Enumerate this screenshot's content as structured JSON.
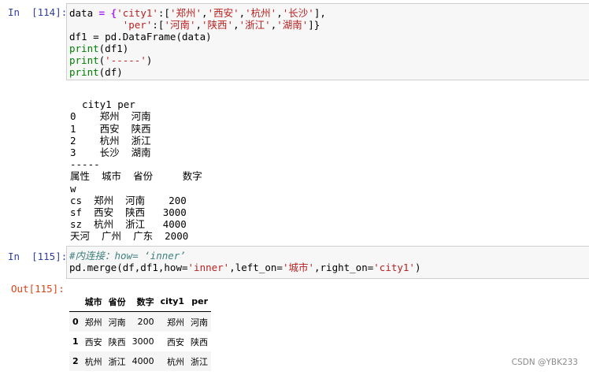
{
  "cell1": {
    "prompt": "In  [114]:",
    "code": {
      "l1_a": "data",
      "l1_b": " = {",
      "l1_c": "'city1'",
      "l1_d": ":[",
      "l1_e": "'郑州'",
      "l1_f": ",",
      "l1_g": "'西安'",
      "l1_h": ",",
      "l1_i": "'杭州'",
      "l1_j": ",",
      "l1_k": "'长沙'",
      "l1_l": "],",
      "l2_indent": "         ",
      "l2_a": "'per'",
      "l2_b": ":[",
      "l2_c": "'河南'",
      "l2_d": ",",
      "l2_e": "'陕西'",
      "l2_f": ",",
      "l2_g": "'浙江'",
      "l2_h": ",",
      "l2_i": "'湖南'",
      "l2_j": "]}",
      "l3_a": "df1",
      "l3_b": " = pd.DataFrame(data)",
      "l4_a": "print",
      "l4_b": "(df1)",
      "l5_a": "print",
      "l5_b": "(",
      "l5_c": "'-----'",
      "l5_d": ")",
      "l6_a": "print",
      "l6_b": "(df)"
    },
    "output_lines": [
      "  city1 per",
      "0    郑州  河南",
      "1    西安  陕西",
      "2    杭州  浙江",
      "3    长沙  湖南",
      "-----",
      "属性  城市  省份     数字",
      "w",
      "cs  郑州  河南    200",
      "sf  西安  陕西   3000",
      "sz  杭州  浙江   4000",
      "天河  广州  广东  2000"
    ]
  },
  "cell2": {
    "prompt": "In  [115]:",
    "out_prompt": "Out[115]:",
    "code": {
      "l1_comment": "#内连接：how= ‘inner’",
      "l2_a": "pd.merge(df,df1,how=",
      "l2_b": "'inner'",
      "l2_c": ",left_on=",
      "l2_d": "'城市'",
      "l2_e": ",right_on=",
      "l2_f": "'city1'",
      "l2_g": ")"
    },
    "table": {
      "columns": [
        "",
        "城市",
        "省份",
        "数字",
        "city1",
        "per"
      ],
      "rows": [
        [
          "0",
          "郑州",
          "河南",
          "200",
          "郑州",
          "河南"
        ],
        [
          "1",
          "西安",
          "陕西",
          "3000",
          "西安",
          "陕西"
        ],
        [
          "2",
          "杭州",
          "浙江",
          "4000",
          "杭州",
          "浙江"
        ]
      ]
    }
  },
  "watermark": "CSDN @YBK233"
}
